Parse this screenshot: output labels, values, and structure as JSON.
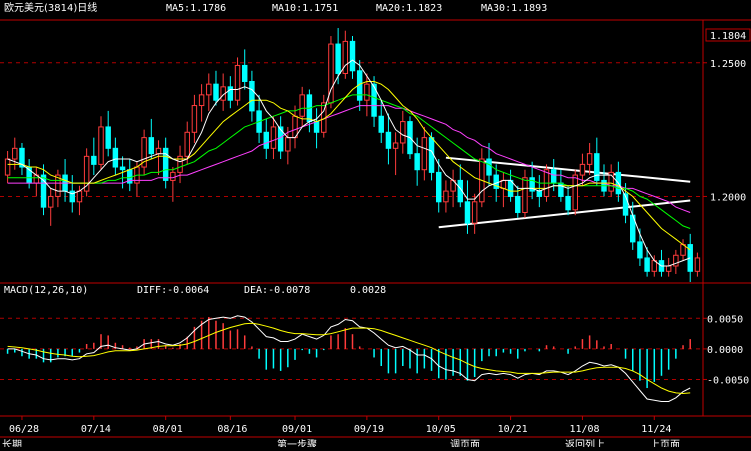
{
  "header": {
    "symbol_title": "欧元美元(3814)日线",
    "ma5": "MA5:1.1786",
    "ma10": "MA10:1.1751",
    "ma20": "MA20:1.1823",
    "ma30": "MA30:1.1893",
    "current_price": "1.1804"
  },
  "macd_header": {
    "title": "MACD(12,26,10)",
    "diff": "DIFF:-0.0064",
    "dea": "DEA:-0.0078",
    "value": "0.0028"
  },
  "bottom_tabs": [
    "长期",
    "",
    "",
    "",
    "",
    "",
    "",
    "第一步骤",
    "",
    "",
    "调页面",
    "",
    "",
    "",
    "返回列上",
    "",
    "",
    "上页面"
  ],
  "colors": {
    "up": "#ff3c3c",
    "down": "#00ffff",
    "ma5": "#ffffff",
    "ma10": "#ffff00",
    "ma20": "#00ff00",
    "ma30": "#ff40ff",
    "grid": "#b00000",
    "axis": "#c00000"
  },
  "chart_data": [
    {
      "type": "candlestick",
      "title": "欧元美元(3814)日线",
      "x_ticks": [
        "06/28",
        "07/14",
        "08/01",
        "08/16",
        "09/01",
        "09/19",
        "10/05",
        "10/21",
        "11/08",
        "11/24"
      ],
      "y_ticks": [
        "1.2500",
        "1.2000"
      ],
      "ylim": [
        1.168,
        1.266
      ],
      "ohlc": [
        [
          1.208,
          1.217,
          1.205,
          1.214
        ],
        [
          1.214,
          1.222,
          1.21,
          1.218
        ],
        [
          1.218,
          1.22,
          1.208,
          1.211
        ],
        [
          1.211,
          1.214,
          1.203,
          1.205
        ],
        [
          1.205,
          1.211,
          1.2,
          1.208
        ],
        [
          1.208,
          1.212,
          1.193,
          1.196
        ],
        [
          1.196,
          1.203,
          1.189,
          1.2
        ],
        [
          1.2,
          1.21,
          1.196,
          1.208
        ],
        [
          1.208,
          1.214,
          1.198,
          1.202
        ],
        [
          1.202,
          1.208,
          1.194,
          1.198
        ],
        [
          1.198,
          1.204,
          1.193,
          1.202
        ],
        [
          1.202,
          1.218,
          1.2,
          1.215
        ],
        [
          1.215,
          1.222,
          1.208,
          1.212
        ],
        [
          1.212,
          1.23,
          1.21,
          1.226
        ],
        [
          1.226,
          1.232,
          1.215,
          1.218
        ],
        [
          1.218,
          1.222,
          1.208,
          1.211
        ],
        [
          1.211,
          1.215,
          1.203,
          1.21
        ],
        [
          1.21,
          1.214,
          1.202,
          1.205
        ],
        [
          1.205,
          1.213,
          1.2,
          1.211
        ],
        [
          1.211,
          1.225,
          1.208,
          1.222
        ],
        [
          1.222,
          1.229,
          1.214,
          1.216
        ],
        [
          1.216,
          1.221,
          1.208,
          1.218
        ],
        [
          1.218,
          1.222,
          1.203,
          1.206
        ],
        [
          1.206,
          1.211,
          1.198,
          1.209
        ],
        [
          1.209,
          1.219,
          1.205,
          1.215
        ],
        [
          1.215,
          1.228,
          1.212,
          1.224
        ],
        [
          1.224,
          1.238,
          1.22,
          1.234
        ],
        [
          1.234,
          1.242,
          1.228,
          1.238
        ],
        [
          1.238,
          1.246,
          1.232,
          1.242
        ],
        [
          1.242,
          1.247,
          1.234,
          1.236
        ],
        [
          1.236,
          1.246,
          1.232,
          1.241
        ],
        [
          1.241,
          1.245,
          1.233,
          1.236
        ],
        [
          1.236,
          1.252,
          1.234,
          1.249
        ],
        [
          1.249,
          1.255,
          1.24,
          1.243
        ],
        [
          1.243,
          1.247,
          1.228,
          1.232
        ],
        [
          1.232,
          1.238,
          1.22,
          1.224
        ],
        [
          1.224,
          1.229,
          1.214,
          1.218
        ],
        [
          1.218,
          1.23,
          1.214,
          1.226
        ],
        [
          1.226,
          1.23,
          1.214,
          1.217
        ],
        [
          1.217,
          1.226,
          1.212,
          1.222
        ],
        [
          1.222,
          1.234,
          1.218,
          1.23
        ],
        [
          1.23,
          1.241,
          1.226,
          1.238
        ],
        [
          1.238,
          1.24,
          1.224,
          1.228
        ],
        [
          1.228,
          1.233,
          1.218,
          1.224
        ],
        [
          1.224,
          1.238,
          1.222,
          1.235
        ],
        [
          1.235,
          1.26,
          1.233,
          1.257
        ],
        [
          1.257,
          1.263,
          1.242,
          1.246
        ],
        [
          1.246,
          1.262,
          1.244,
          1.258
        ],
        [
          1.258,
          1.26,
          1.244,
          1.247
        ],
        [
          1.247,
          1.251,
          1.232,
          1.236
        ],
        [
          1.236,
          1.246,
          1.23,
          1.242
        ],
        [
          1.242,
          1.245,
          1.226,
          1.23
        ],
        [
          1.23,
          1.236,
          1.22,
          1.224
        ],
        [
          1.224,
          1.231,
          1.212,
          1.218
        ],
        [
          1.218,
          1.224,
          1.208,
          1.22
        ],
        [
          1.22,
          1.232,
          1.216,
          1.228
        ],
        [
          1.228,
          1.23,
          1.214,
          1.216
        ],
        [
          1.216,
          1.222,
          1.204,
          1.21
        ],
        [
          1.21,
          1.226,
          1.206,
          1.222
        ],
        [
          1.222,
          1.224,
          1.206,
          1.209
        ],
        [
          1.209,
          1.214,
          1.194,
          1.198
        ],
        [
          1.198,
          1.206,
          1.194,
          1.202
        ],
        [
          1.202,
          1.21,
          1.196,
          1.206
        ],
        [
          1.206,
          1.212,
          1.196,
          1.198
        ],
        [
          1.198,
          1.206,
          1.186,
          1.19
        ],
        [
          1.19,
          1.201,
          1.186,
          1.198
        ],
        [
          1.198,
          1.218,
          1.196,
          1.214
        ],
        [
          1.214,
          1.22,
          1.204,
          1.208
        ],
        [
          1.208,
          1.212,
          1.198,
          1.203
        ],
        [
          1.203,
          1.209,
          1.196,
          1.206
        ],
        [
          1.206,
          1.21,
          1.198,
          1.2
        ],
        [
          1.2,
          1.204,
          1.192,
          1.194
        ],
        [
          1.194,
          1.21,
          1.192,
          1.207
        ],
        [
          1.207,
          1.213,
          1.199,
          1.202
        ],
        [
          1.202,
          1.208,
          1.196,
          1.2
        ],
        [
          1.2,
          1.212,
          1.198,
          1.21
        ],
        [
          1.21,
          1.214,
          1.202,
          1.205
        ],
        [
          1.205,
          1.21,
          1.198,
          1.2
        ],
        [
          1.2,
          1.204,
          1.193,
          1.195
        ],
        [
          1.195,
          1.21,
          1.193,
          1.208
        ],
        [
          1.208,
          1.216,
          1.204,
          1.212
        ],
        [
          1.212,
          1.22,
          1.208,
          1.216
        ],
        [
          1.216,
          1.222,
          1.204,
          1.206
        ],
        [
          1.206,
          1.212,
          1.2,
          1.202
        ],
        [
          1.202,
          1.212,
          1.2,
          1.209
        ],
        [
          1.209,
          1.213,
          1.198,
          1.201
        ],
        [
          1.201,
          1.205,
          1.19,
          1.193
        ],
        [
          1.193,
          1.198,
          1.18,
          1.183
        ],
        [
          1.183,
          1.188,
          1.174,
          1.177
        ],
        [
          1.177,
          1.181,
          1.17,
          1.172
        ],
        [
          1.172,
          1.178,
          1.17,
          1.176
        ],
        [
          1.176,
          1.18,
          1.17,
          1.172
        ],
        [
          1.172,
          1.177,
          1.17,
          1.174
        ],
        [
          1.174,
          1.18,
          1.171,
          1.178
        ],
        [
          1.178,
          1.184,
          1.176,
          1.182
        ],
        [
          1.182,
          1.186,
          1.168,
          1.172
        ],
        [
          1.172,
          1.179,
          1.17,
          1.177
        ]
      ],
      "ma": {
        "ma5": [
          1.214,
          1.213,
          1.212,
          1.21,
          1.208,
          1.206,
          1.203,
          1.202,
          1.202,
          1.201,
          1.202,
          1.204,
          1.207,
          1.21,
          1.213,
          1.214,
          1.214,
          1.214,
          1.213,
          1.214,
          1.215,
          1.216,
          1.216,
          1.214,
          1.213,
          1.214,
          1.219,
          1.224,
          1.231,
          1.235,
          1.238,
          1.24,
          1.24,
          1.241,
          1.24,
          1.237,
          1.232,
          1.229,
          1.225,
          1.222,
          1.222,
          1.226,
          1.228,
          1.229,
          1.232,
          1.24,
          1.245,
          1.249,
          1.251,
          1.249,
          1.245,
          1.241,
          1.236,
          1.23,
          1.225,
          1.223,
          1.222,
          1.219,
          1.218,
          1.217,
          1.212,
          1.208,
          1.206,
          1.203,
          1.199,
          1.199,
          1.202,
          1.204,
          1.205,
          1.206,
          1.206,
          1.203,
          1.203,
          1.203,
          1.202,
          1.203,
          1.204,
          1.204,
          1.203,
          1.204,
          1.205,
          1.207,
          1.208,
          1.208,
          1.208,
          1.205,
          1.2,
          1.193,
          1.186,
          1.18,
          1.176,
          1.174,
          1.174,
          1.175,
          1.176,
          1.177
        ],
        "ma10": [
          1.212,
          1.212,
          1.212,
          1.211,
          1.211,
          1.21,
          1.208,
          1.207,
          1.206,
          1.205,
          1.205,
          1.205,
          1.205,
          1.206,
          1.207,
          1.208,
          1.209,
          1.21,
          1.211,
          1.213,
          1.214,
          1.215,
          1.215,
          1.214,
          1.214,
          1.214,
          1.216,
          1.219,
          1.222,
          1.225,
          1.228,
          1.23,
          1.232,
          1.234,
          1.236,
          1.236,
          1.236,
          1.235,
          1.233,
          1.232,
          1.23,
          1.229,
          1.229,
          1.228,
          1.229,
          1.231,
          1.234,
          1.237,
          1.24,
          1.242,
          1.243,
          1.243,
          1.242,
          1.24,
          1.237,
          1.234,
          1.232,
          1.229,
          1.225,
          1.222,
          1.219,
          1.216,
          1.213,
          1.211,
          1.209,
          1.207,
          1.206,
          1.205,
          1.204,
          1.203,
          1.202,
          1.202,
          1.203,
          1.203,
          1.203,
          1.203,
          1.204,
          1.204,
          1.204,
          1.204,
          1.204,
          1.205,
          1.205,
          1.205,
          1.205,
          1.204,
          1.202,
          1.2,
          1.197,
          1.194,
          1.191,
          1.188,
          1.186,
          1.184,
          1.182,
          1.18
        ],
        "ma20": [
          1.207,
          1.207,
          1.207,
          1.207,
          1.207,
          1.207,
          1.206,
          1.206,
          1.206,
          1.205,
          1.205,
          1.205,
          1.205,
          1.205,
          1.206,
          1.206,
          1.207,
          1.207,
          1.208,
          1.208,
          1.209,
          1.209,
          1.21,
          1.21,
          1.211,
          1.212,
          1.213,
          1.215,
          1.217,
          1.218,
          1.22,
          1.222,
          1.224,
          1.226,
          1.227,
          1.228,
          1.229,
          1.23,
          1.231,
          1.232,
          1.232,
          1.233,
          1.233,
          1.234,
          1.234,
          1.235,
          1.236,
          1.237,
          1.238,
          1.238,
          1.238,
          1.237,
          1.236,
          1.235,
          1.234,
          1.233,
          1.231,
          1.23,
          1.228,
          1.226,
          1.224,
          1.222,
          1.22,
          1.218,
          1.216,
          1.214,
          1.213,
          1.212,
          1.21,
          1.209,
          1.208,
          1.207,
          1.206,
          1.206,
          1.205,
          1.205,
          1.205,
          1.205,
          1.204,
          1.204,
          1.204,
          1.204,
          1.204,
          1.204,
          1.204,
          1.203,
          1.203,
          1.202,
          1.2,
          1.199,
          1.197,
          1.195,
          1.193,
          1.191,
          1.189,
          1.188
        ],
        "ma30": [
          1.205,
          1.205,
          1.205,
          1.205,
          1.205,
          1.205,
          1.205,
          1.205,
          1.205,
          1.205,
          1.205,
          1.205,
          1.205,
          1.205,
          1.205,
          1.205,
          1.205,
          1.206,
          1.206,
          1.206,
          1.206,
          1.207,
          1.207,
          1.207,
          1.208,
          1.208,
          1.209,
          1.21,
          1.211,
          1.212,
          1.213,
          1.214,
          1.215,
          1.216,
          1.217,
          1.219,
          1.22,
          1.221,
          1.222,
          1.224,
          1.225,
          1.226,
          1.227,
          1.228,
          1.229,
          1.23,
          1.231,
          1.232,
          1.233,
          1.234,
          1.234,
          1.234,
          1.234,
          1.234,
          1.233,
          1.233,
          1.232,
          1.231,
          1.23,
          1.229,
          1.228,
          1.227,
          1.225,
          1.224,
          1.222,
          1.221,
          1.219,
          1.218,
          1.216,
          1.215,
          1.214,
          1.213,
          1.212,
          1.211,
          1.21,
          1.209,
          1.208,
          1.208,
          1.207,
          1.207,
          1.206,
          1.206,
          1.205,
          1.205,
          1.204,
          1.204,
          1.203,
          1.203,
          1.202,
          1.201,
          1.2,
          1.199,
          1.198,
          1.196,
          1.195,
          1.194
        ]
      },
      "trendlines": [
        {
          "from": [
            61,
            1.2145
          ],
          "to": [
            95,
            1.2055
          ]
        },
        {
          "from": [
            60,
            1.1885
          ],
          "to": [
            95,
            1.1985
          ]
        }
      ]
    },
    {
      "type": "macd",
      "title": "MACD(12,26,10)",
      "y_ticks": [
        "0.0050",
        "0.0000",
        "-0.0050"
      ],
      "ylim": [
        -0.0095,
        0.0075
      ],
      "diff": [
        0.0,
        0.0,
        -0.0004,
        -0.0008,
        -0.001,
        -0.0016,
        -0.0018,
        -0.0016,
        -0.0016,
        -0.0018,
        -0.0016,
        -0.0008,
        -0.0006,
        0.0004,
        0.0006,
        0.0002,
        0.0,
        -0.0002,
        0.0,
        0.0008,
        0.001,
        0.0012,
        0.0008,
        0.0006,
        0.001,
        0.0018,
        0.003,
        0.004,
        0.0048,
        0.005,
        0.0052,
        0.005,
        0.0054,
        0.0052,
        0.0044,
        0.0032,
        0.002,
        0.0018,
        0.0012,
        0.0012,
        0.0016,
        0.0024,
        0.002,
        0.0016,
        0.0022,
        0.0036,
        0.004,
        0.0048,
        0.0046,
        0.0036,
        0.0034,
        0.0026,
        0.0016,
        0.0006,
        0.0002,
        0.0004,
        -0.0002,
        -0.001,
        -0.001,
        -0.0016,
        -0.0028,
        -0.0034,
        -0.0036,
        -0.004,
        -0.005,
        -0.0052,
        -0.0042,
        -0.004,
        -0.0042,
        -0.004,
        -0.0042,
        -0.0048,
        -0.0042,
        -0.004,
        -0.0042,
        -0.0036,
        -0.0036,
        -0.0038,
        -0.0042,
        -0.0036,
        -0.0028,
        -0.0022,
        -0.0024,
        -0.0028,
        -0.0026,
        -0.003,
        -0.004,
        -0.0054,
        -0.0068,
        -0.0082,
        -0.0084,
        -0.0086,
        -0.0086,
        -0.008,
        -0.007,
        -0.0064
      ],
      "dea": [
        0.0004,
        0.0003,
        0.0002,
        0.0,
        -0.0002,
        -0.0005,
        -0.0007,
        -0.0009,
        -0.001,
        -0.0012,
        -0.0013,
        -0.0012,
        -0.0011,
        -0.0008,
        -0.0005,
        -0.0003,
        -0.0003,
        -0.0003,
        -0.0002,
        0.0,
        0.0002,
        0.0004,
        0.0005,
        0.0005,
        0.0006,
        0.0008,
        0.0012,
        0.0017,
        0.0022,
        0.0027,
        0.0031,
        0.0035,
        0.0038,
        0.0041,
        0.0042,
        0.004,
        0.0037,
        0.0034,
        0.003,
        0.0027,
        0.0025,
        0.0025,
        0.0024,
        0.0023,
        0.0023,
        0.0025,
        0.0028,
        0.0031,
        0.0034,
        0.0034,
        0.0034,
        0.0033,
        0.003,
        0.0026,
        0.0022,
        0.0018,
        0.0014,
        0.001,
        0.0006,
        0.0002,
        -0.0004,
        -0.0009,
        -0.0014,
        -0.0018,
        -0.0024,
        -0.0029,
        -0.0032,
        -0.0034,
        -0.0036,
        -0.0037,
        -0.0038,
        -0.004,
        -0.004,
        -0.004,
        -0.004,
        -0.0039,
        -0.0038,
        -0.0038,
        -0.0038,
        -0.0038,
        -0.0036,
        -0.0033,
        -0.0031,
        -0.003,
        -0.003,
        -0.003,
        -0.0032,
        -0.0036,
        -0.0042,
        -0.005,
        -0.0057,
        -0.0064,
        -0.0069,
        -0.0072,
        -0.0073,
        -0.0072
      ]
    }
  ]
}
